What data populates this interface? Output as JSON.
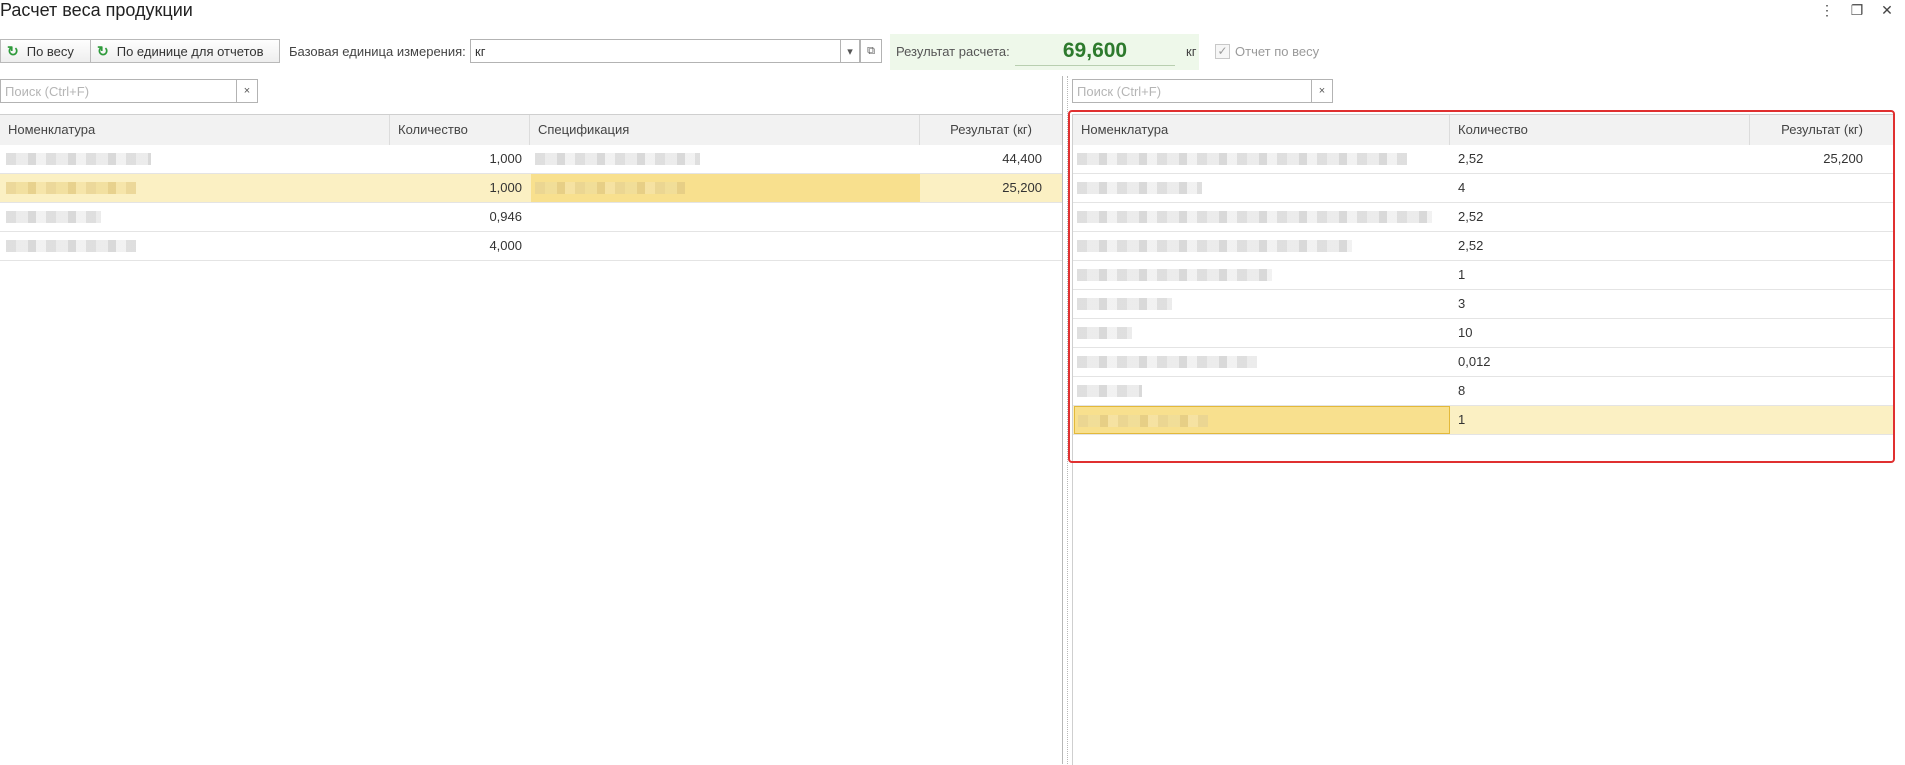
{
  "window": {
    "title": "Расчет веса продукции"
  },
  "toolbar": {
    "by_weight_label": "По весу",
    "by_report_unit_label": "По единице для отчетов",
    "base_unit_label": "Базовая единица измерения:",
    "base_unit_value": "кг",
    "result_label": "Результат расчета:",
    "result_value": "69,600",
    "result_unit": "кг",
    "report_by_weight_label": "Отчет по весу",
    "report_by_weight_checked": true
  },
  "left_search": {
    "placeholder": "Поиск (Ctrl+F)",
    "clear_label": "×"
  },
  "right_search": {
    "placeholder": "Поиск (Ctrl+F)",
    "clear_label": "×"
  },
  "left_table": {
    "columns": [
      "Номенклатура",
      "Количество",
      "Спецификация",
      "Результат (кг)"
    ],
    "rows": [
      {
        "quantity": "1,000",
        "result": "44,400",
        "selected": false
      },
      {
        "quantity": "1,000",
        "result": "25,200",
        "selected": true
      },
      {
        "quantity": "0,946",
        "result": "",
        "selected": false
      },
      {
        "quantity": "4,000",
        "result": "",
        "selected": false
      }
    ]
  },
  "right_table": {
    "columns": [
      "Номенклатура",
      "Количество",
      "Результат (кг)"
    ],
    "rows": [
      {
        "quantity": "2,52",
        "result": "25,200",
        "selected": false
      },
      {
        "quantity": "4",
        "result": "",
        "selected": false
      },
      {
        "quantity": "2,52",
        "result": "",
        "selected": false
      },
      {
        "quantity": "2,52",
        "result": "",
        "selected": false
      },
      {
        "quantity": "1",
        "result": "",
        "selected": false
      },
      {
        "quantity": "3",
        "result": "",
        "selected": false
      },
      {
        "quantity": "10",
        "result": "",
        "selected": false
      },
      {
        "quantity": "0,012",
        "result": "",
        "selected": false
      },
      {
        "quantity": "8",
        "result": "",
        "selected": false
      },
      {
        "quantity": "1",
        "result": "",
        "selected": true
      }
    ]
  },
  "colors": {
    "accent_green": "#2d7a2d",
    "selection": "#fbf0c3",
    "highlight_frame": "#e03030"
  }
}
